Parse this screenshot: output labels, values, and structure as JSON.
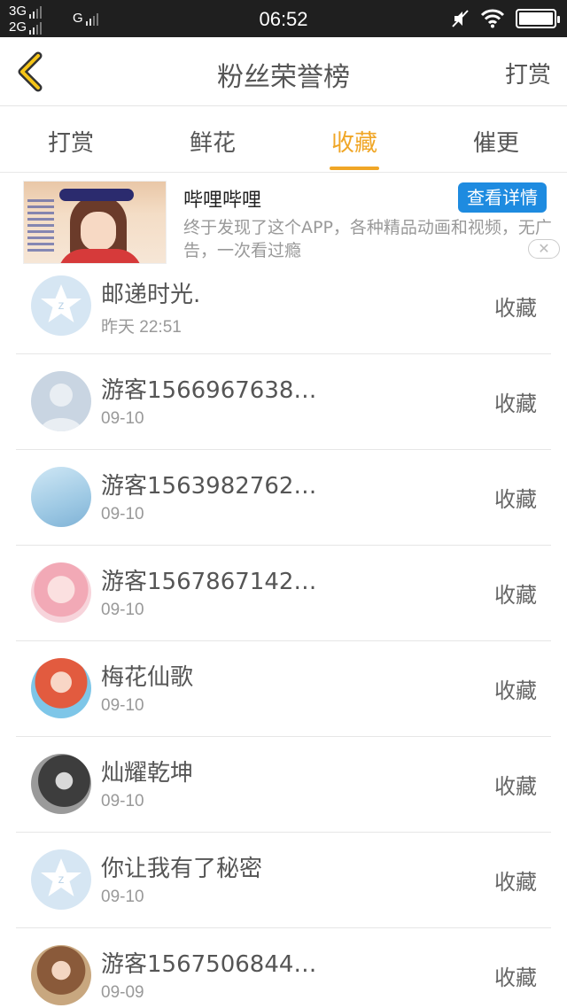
{
  "status_bar": {
    "network_top": "3G",
    "network_bottom": "2G",
    "network_g": "G",
    "time": "06:52"
  },
  "header": {
    "title": "粉丝荣誉榜",
    "right_label": "打赏"
  },
  "tabs": [
    {
      "label": "打赏",
      "active": false
    },
    {
      "label": "鲜花",
      "active": false
    },
    {
      "label": "收藏",
      "active": true
    },
    {
      "label": "催更",
      "active": false
    }
  ],
  "ad": {
    "name": "哔哩哔哩",
    "button": "查看详情",
    "description": "终于发现了这个APP，各种精品动画和视频，无广告，一次看过瘾"
  },
  "list": [
    {
      "name": "邮递时光.",
      "date": "昨天 22:51",
      "action": "收藏",
      "avatar": "default-avatar"
    },
    {
      "name": "游客1566967638…",
      "date": "09-10",
      "action": "收藏",
      "avatar": "person-avatar"
    },
    {
      "name": "游客1563982762…",
      "date": "09-10",
      "action": "收藏",
      "avatar": "user-avatar"
    },
    {
      "name": "游客1567867142…",
      "date": "09-10",
      "action": "收藏",
      "avatar": "user-avatar"
    },
    {
      "name": "梅花仙歌",
      "date": "09-10",
      "action": "收藏",
      "avatar": "user-avatar"
    },
    {
      "name": "灿耀乾坤",
      "date": "09-10",
      "action": "收藏",
      "avatar": "user-avatar"
    },
    {
      "name": "你让我有了秘密",
      "date": "09-10",
      "action": "收藏",
      "avatar": "default-avatar"
    },
    {
      "name": "游客1567506844…",
      "date": "09-09",
      "action": "收藏",
      "avatar": "user-avatar"
    }
  ],
  "colors": {
    "accent": "#f0a626",
    "ad_button": "#1e8be0",
    "status_bar": "#1f1f1f"
  }
}
